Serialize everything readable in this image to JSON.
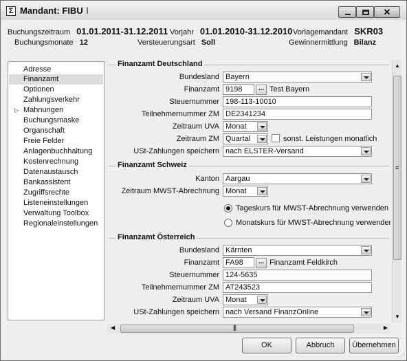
{
  "window": {
    "title": "Mandant: FIBU",
    "icon": "sigma-app-icon",
    "buttons": {
      "minimize": "",
      "maximize": "",
      "close": "✕"
    }
  },
  "header": {
    "buchungszeitraum_label": "Buchungszeitraum",
    "buchungszeitraum_value": "01.01.2011-31.12.2011",
    "vorjahr_label": "Vorjahr",
    "vorjahr_value": "01.01.2010-31.12.2010",
    "vorlagemandant_label": "Vorlagemandant",
    "vorlagemandant_value": "SKR03",
    "buchungsmonate_label": "Buchungsmonate",
    "buchungsmonate_value": "12",
    "versteuerungsart_label": "Versteuerungsart",
    "versteuerungsart_value": "Soll",
    "gewinnermittlung_label": "Gewinnermittlung",
    "gewinnermittlung_value": "Bilanz"
  },
  "nav": {
    "selected": "Finanzamt",
    "items": [
      {
        "label": "Adresse"
      },
      {
        "label": "Finanzamt"
      },
      {
        "label": "Optionen"
      },
      {
        "label": "Zahlungsverkehr"
      },
      {
        "label": "Mahnungen"
      },
      {
        "label": "Buchungsmaske"
      },
      {
        "label": "Organschaft"
      },
      {
        "label": "Freie Felder"
      },
      {
        "label": "Anlagenbuchhaltung"
      },
      {
        "label": "Kostenrechnung"
      },
      {
        "label": "Datenaustausch"
      },
      {
        "label": "Bankassistent"
      },
      {
        "label": "Zugriffsrechte"
      },
      {
        "label": "Listeneinstellungen"
      },
      {
        "label": "Verwaltung Toolbox"
      },
      {
        "label": "Regionaleinstellungen"
      }
    ]
  },
  "de": {
    "title": "Finanzamt Deutschland",
    "bundesland_label": "Bundesland",
    "bundesland_value": "Bayern",
    "finanzamt_label": "Finanzamt",
    "finanzamt_code": "9198",
    "finanzamt_name": "Test Bayern",
    "steuernummer_label": "Steuernummer",
    "steuernummer_value": "198-113-10010",
    "teilnehmer_label": "Teilnehmernummer ZM",
    "teilnehmer_value": "DE2341234",
    "zeitraum_uva_label": "Zeitraum UVA",
    "zeitraum_uva_value": "Monat",
    "zeitraum_zm_label": "Zeitraum ZM",
    "zeitraum_zm_value": "Quartal",
    "sonst_label": "sonst. Leistungen monatlich",
    "sonst_checked": false,
    "ust_label": "USt-Zahlungen speichern",
    "ust_value": "nach ELSTER-Versand"
  },
  "ch": {
    "title": "Finanzamt Schweiz",
    "kanton_label": "Kanton",
    "kanton_value": "Aargau",
    "zeitraum_label": "Zeitraum MWST-Abrechnung",
    "zeitraum_value": "Monat",
    "radio_tageskurs": "Tageskurs für MWST-Abrechnung verwenden",
    "radio_monatskurs": "Monatskurs für MWST-Abrechnung verwenden",
    "radio_selected": "tageskurs"
  },
  "at": {
    "title": "Finanzamt Österreich",
    "bundesland_label": "Bundesland",
    "bundesland_value": "Kärnten",
    "finanzamt_label": "Finanzamt",
    "finanzamt_code": "FA98",
    "finanzamt_name": "Finanzamt Feldkirch",
    "steuernummer_label": "Steuernummer",
    "steuernummer_value": "124-5635",
    "teilnehmer_label": "Teilnehmernummer ZM",
    "teilnehmer_value": "AT243523",
    "zeitraum_uva_label": "Zeitraum UVA",
    "zeitraum_uva_value": "Monat",
    "ust_label": "USt-Zahlungen speichern",
    "ust_value": "nach Versand FinanzOnline"
  },
  "buttons": {
    "ok": "OK",
    "abbruch": "Abbruch",
    "uebernehmen": "Übernehmen"
  },
  "browse_label": "..."
}
